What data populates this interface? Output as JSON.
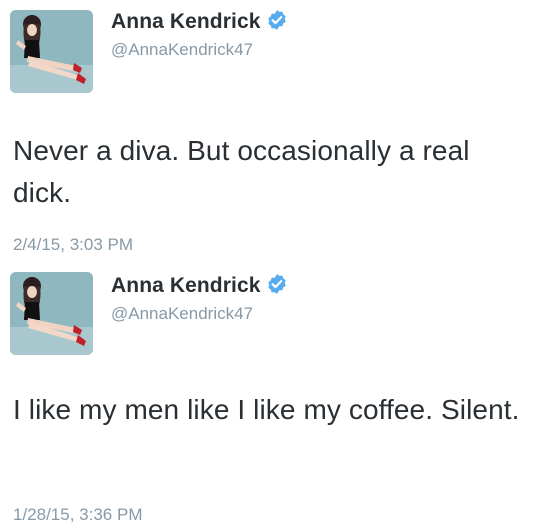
{
  "tweets": [
    {
      "display_name": "Anna Kendrick",
      "handle": "@AnnaKendrick47",
      "text": "Never a diva. But occasionally a real dick.",
      "timestamp": "2/4/15, 3:03 PM",
      "verified": true,
      "avatar_icon": "profile-photo"
    },
    {
      "display_name": "Anna Kendrick",
      "handle": "@AnnaKendrick47",
      "text": "I like my men like I like my coffee. Silent.",
      "timestamp": "1/28/15, 3:36 PM",
      "verified": true,
      "avatar_icon": "profile-photo"
    }
  ],
  "colors": {
    "verified_badge": "#55acee",
    "secondary_text": "#8899a6",
    "primary_text": "#292f33",
    "avatar_bg": "#8fb7bf"
  }
}
